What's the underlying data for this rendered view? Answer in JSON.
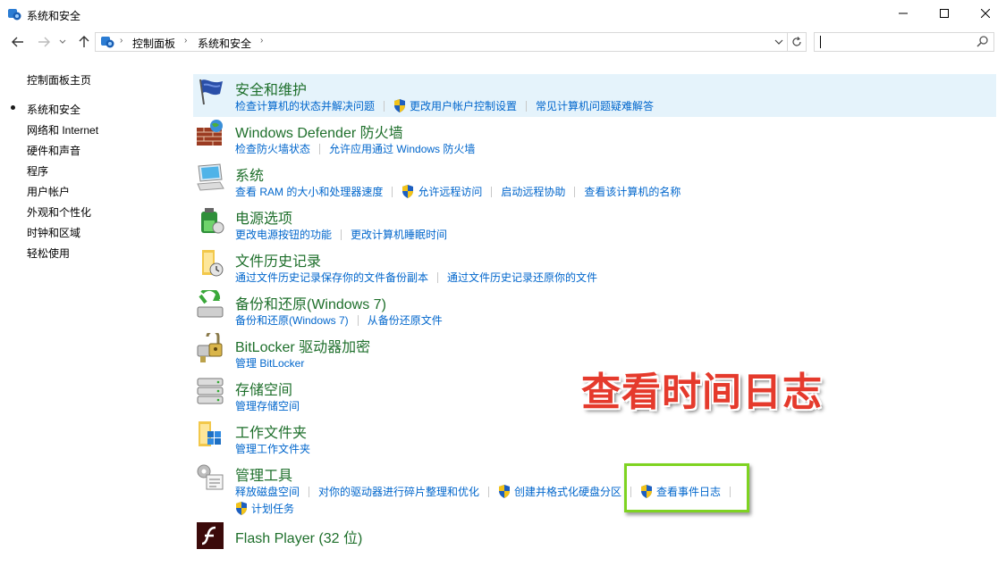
{
  "window": {
    "title": "系统和安全",
    "minimize_icon": "minimize-icon",
    "maximize_icon": "maximize-icon",
    "close_icon": "close-icon"
  },
  "nav": {
    "breadcrumbs": [
      "控制面板",
      "系统和安全"
    ],
    "search_placeholder": ""
  },
  "sidebar": {
    "items": [
      {
        "label": "控制面板主页",
        "active": false
      },
      {
        "label": "系统和安全",
        "active": true
      },
      {
        "label": "网络和 Internet",
        "active": false
      },
      {
        "label": "硬件和声音",
        "active": false
      },
      {
        "label": "程序",
        "active": false
      },
      {
        "label": "用户帐户",
        "active": false
      },
      {
        "label": "外观和个性化",
        "active": false
      },
      {
        "label": "时钟和区域",
        "active": false
      },
      {
        "label": "轻松使用",
        "active": false
      }
    ]
  },
  "categories": [
    {
      "title": "安全和维护",
      "icon": "flag-icon",
      "links": [
        {
          "label": "检查计算机的状态并解决问题",
          "shield": false
        },
        {
          "label": "更改用户帐户控制设置",
          "shield": true
        },
        {
          "label": "常见计算机问题疑难解答",
          "shield": false
        }
      ]
    },
    {
      "title": "Windows Defender 防火墙",
      "icon": "firewall-icon",
      "links": [
        {
          "label": "检查防火墙状态",
          "shield": false
        },
        {
          "label": "允许应用通过 Windows 防火墙",
          "shield": false
        }
      ]
    },
    {
      "title": "系统",
      "icon": "computer-icon",
      "links": [
        {
          "label": "查看 RAM 的大小和处理器速度",
          "shield": false
        },
        {
          "label": "允许远程访问",
          "shield": true
        },
        {
          "label": "启动远程协助",
          "shield": false
        },
        {
          "label": "查看该计算机的名称",
          "shield": false
        }
      ]
    },
    {
      "title": "电源选项",
      "icon": "power-icon",
      "links": [
        {
          "label": "更改电源按钮的功能",
          "shield": false
        },
        {
          "label": "更改计算机睡眠时间",
          "shield": false
        }
      ]
    },
    {
      "title": "文件历史记录",
      "icon": "file-history-icon",
      "links": [
        {
          "label": "通过文件历史记录保存你的文件备份副本",
          "shield": false
        },
        {
          "label": "通过文件历史记录还原你的文件",
          "shield": false
        }
      ]
    },
    {
      "title": "备份和还原(Windows 7)",
      "icon": "backup-icon",
      "links": [
        {
          "label": "备份和还原(Windows 7)",
          "shield": false
        },
        {
          "label": "从备份还原文件",
          "shield": false
        }
      ]
    },
    {
      "title": "BitLocker 驱动器加密",
      "icon": "bitlocker-icon",
      "links": [
        {
          "label": "管理 BitLocker",
          "shield": false
        }
      ]
    },
    {
      "title": "存储空间",
      "icon": "storage-icon",
      "links": [
        {
          "label": "管理存储空间",
          "shield": false
        }
      ]
    },
    {
      "title": "工作文件夹",
      "icon": "work-folders-icon",
      "links": [
        {
          "label": "管理工作文件夹",
          "shield": false
        }
      ]
    },
    {
      "title": "管理工具",
      "icon": "admin-tools-icon",
      "links": [
        {
          "label": "释放磁盘空间",
          "shield": false
        },
        {
          "label": "对你的驱动器进行碎片整理和优化",
          "shield": false
        },
        {
          "label": "创建并格式化硬盘分区",
          "shield": true
        },
        {
          "label": "查看事件日志",
          "shield": true
        }
      ],
      "links2": [
        {
          "label": "计划任务",
          "shield": true
        }
      ]
    },
    {
      "title": "Flash Player (32 位)",
      "icon": "flash-icon",
      "links": []
    }
  ],
  "annotation": {
    "text": "查看时间日志",
    "color": "#e53a2c",
    "box_color": "#7ed321"
  },
  "colors": {
    "link": "#0066cc",
    "heading": "#1e6f2b",
    "highlight": "#e5f3fb"
  }
}
